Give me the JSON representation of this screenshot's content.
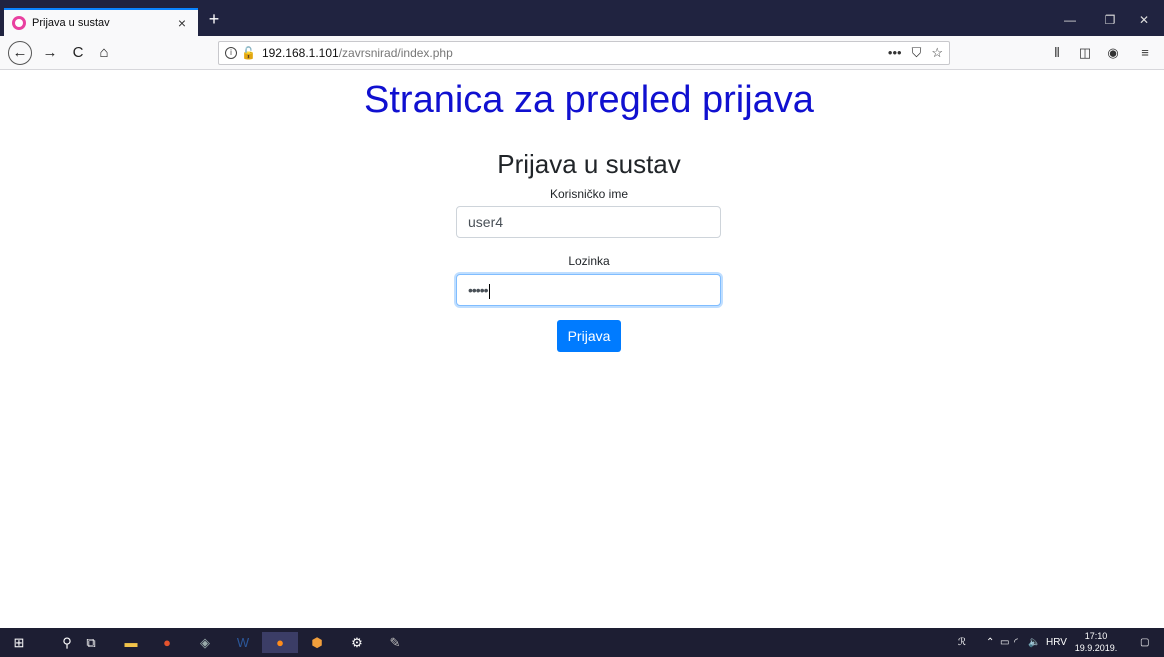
{
  "tab": {
    "title": "Prijava u sustav",
    "close": "×",
    "new": "+"
  },
  "window": {
    "minimize": "—",
    "restore": "❐",
    "close": "✕"
  },
  "nav": {
    "back": "←",
    "forward": "→",
    "reload": "C",
    "home": "⌂"
  },
  "url": {
    "host": "192.168.1.101",
    "path": "/zavrsnirad/index.php",
    "actions": [
      "•••",
      "⛉",
      "☆"
    ]
  },
  "tools": [
    "⫴",
    "◫",
    "◉",
    "≡"
  ],
  "page": {
    "heading": "Stranica za pregled prijava",
    "form_title": "Prijava u sustav",
    "username_label": "Korisničko ime",
    "username_value": "user4",
    "password_label": "Lozinka",
    "password_value": "•••••",
    "submit_label": "Prijava"
  },
  "taskbar": {
    "tray_language": "HRV",
    "time": "17:10",
    "date": "19.9.2019."
  },
  "colors": {
    "heading": "#1010d0",
    "button": "#007bff",
    "tab_accent": "#0a84ff",
    "taskbar": "#1d1e33"
  }
}
